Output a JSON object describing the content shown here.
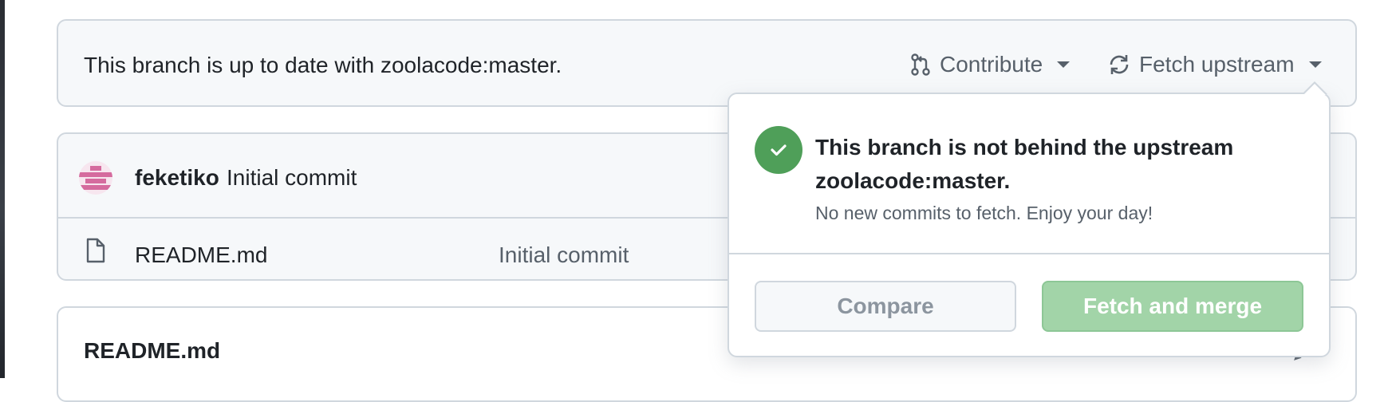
{
  "status_bar": {
    "message": "This branch is up to date with zoolacode:master.",
    "contribute_label": "Contribute",
    "fetch_upstream_label": "Fetch upstream"
  },
  "commit": {
    "author": "feketiko",
    "message": "Initial commit"
  },
  "files": [
    {
      "name": "README.md",
      "last_commit": "Initial commit"
    }
  ],
  "readme": {
    "title": "README.md"
  },
  "popover": {
    "title": "This branch is not behind the upstream zoolacode:master.",
    "subtitle": "No new commits to fetch. Enjoy your day!",
    "compare_label": "Compare",
    "fetch_merge_label": "Fetch and merge"
  },
  "colors": {
    "success": "#4f9f59",
    "merge_button_disabled": "#a2d4a8",
    "border": "#d0d7de"
  },
  "icons": [
    "git-pull-request-icon",
    "sync-icon",
    "file-icon",
    "check-icon",
    "pencil-icon",
    "caret-down-icon"
  ]
}
